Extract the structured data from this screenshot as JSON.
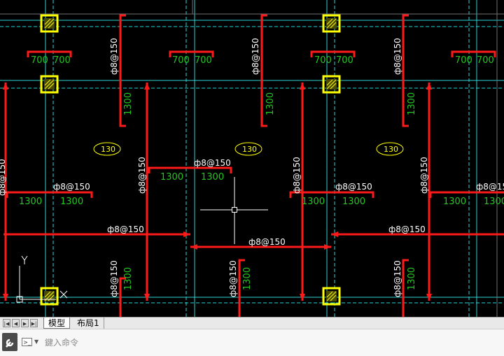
{
  "drawing": {
    "rebar_labels": [
      "ф8@150",
      "ф8@150",
      "ф8@150",
      "ф8@150",
      "ф8@150",
      "ф8@150",
      "ф8@150",
      "ф8@150",
      "ф8@150",
      "ф8@150",
      "ф8@150",
      "ф8@150",
      "ф8@150",
      "ф8@150",
      "ф8@150",
      "ф8@150",
      "ф8@150",
      "ф8@150"
    ],
    "dim_700": "700",
    "dim_1300": "1300",
    "slab_thickness": "130",
    "colors": {
      "rebar": "#ff1a1a",
      "dimension_text": "#22c81e",
      "column": "#ffff00",
      "axis": "#2fd5d5",
      "annotation": "#ffffff",
      "background": "#000000"
    }
  },
  "tabs": {
    "model": "模型",
    "layout1": "布局1"
  },
  "command": {
    "placeholder": "鍵入命令"
  },
  "icons": {
    "nav_first": "nav-first-icon",
    "nav_prev": "nav-prev-icon",
    "nav_next": "nav-next-icon",
    "nav_last": "nav-last-icon",
    "wrench": "wrench-icon",
    "command_prompt": "command-prompt-icon"
  }
}
